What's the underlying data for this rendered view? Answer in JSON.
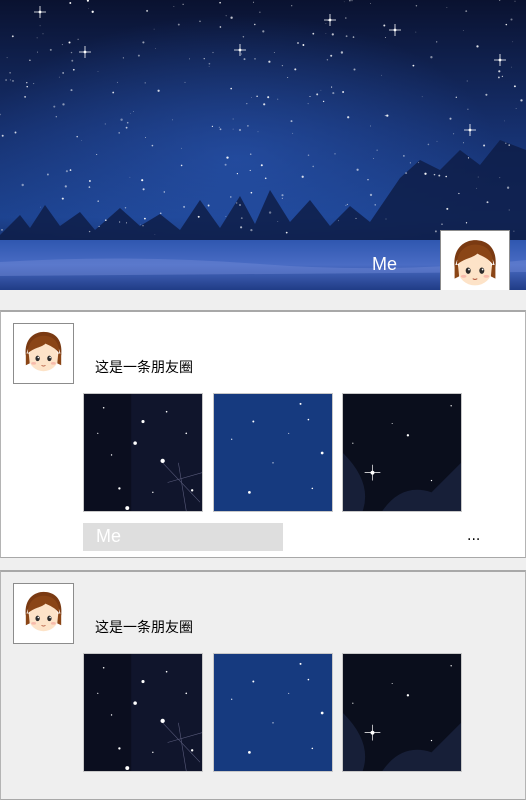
{
  "header": {
    "user_name": "Me",
    "cover_icon": "night-sky-image",
    "avatar_icon": "cartoon-girl-avatar"
  },
  "posts": [
    {
      "text": "这是一条朋友圈",
      "images": [
        "night-sky-stars-1",
        "night-sky-stars-2",
        "night-sky-stars-3"
      ],
      "like_name": "Me",
      "more_label": "..."
    },
    {
      "text": "这是一条朋友圈",
      "images": [
        "night-sky-stars-1",
        "night-sky-stars-2",
        "night-sky-stars-3"
      ]
    }
  ],
  "colors": {
    "sky_dark": "#0c1430",
    "sky_blue": "#1b3f87",
    "card_bg": "#ffffff",
    "page_bg": "#efefef",
    "like_bar": "#dedede"
  }
}
